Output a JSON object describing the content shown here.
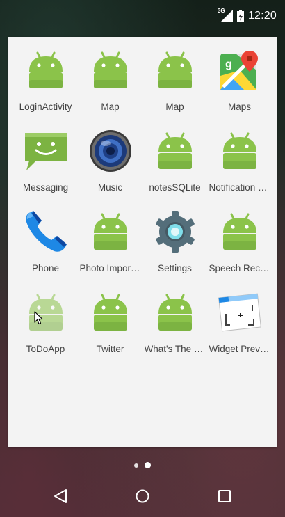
{
  "status_bar": {
    "network": "3G",
    "time": "12:20"
  },
  "apps": [
    {
      "label": "LoginActivity",
      "icon": "android-icon"
    },
    {
      "label": "Map",
      "icon": "android-icon"
    },
    {
      "label": "Map",
      "icon": "android-icon"
    },
    {
      "label": "Maps",
      "icon": "google-maps-icon"
    },
    {
      "label": "Messaging",
      "icon": "messaging-icon"
    },
    {
      "label": "Music",
      "icon": "music-speaker-icon"
    },
    {
      "label": "notesSQLite",
      "icon": "android-icon"
    },
    {
      "label": "Notification D...",
      "icon": "android-icon"
    },
    {
      "label": "Phone",
      "icon": "phone-icon"
    },
    {
      "label": "Photo Import...",
      "icon": "android-icon"
    },
    {
      "label": "Settings",
      "icon": "settings-gear-icon"
    },
    {
      "label": "Speech Recor...",
      "icon": "android-icon"
    },
    {
      "label": "ToDoApp",
      "icon": "android-icon"
    },
    {
      "label": "Twitter",
      "icon": "android-icon"
    },
    {
      "label": "What's The W...",
      "icon": "android-icon"
    },
    {
      "label": "Widget Previe...",
      "icon": "widget-preview-icon"
    }
  ],
  "colors": {
    "android_green": "#8bc34a",
    "panel_background": "#f3f3f3",
    "label_text": "#444444"
  },
  "page_indicator": {
    "pages": 2,
    "current": 2
  },
  "nav_bar": {
    "back": "back-icon",
    "home": "home-icon",
    "recents": "recents-icon"
  }
}
